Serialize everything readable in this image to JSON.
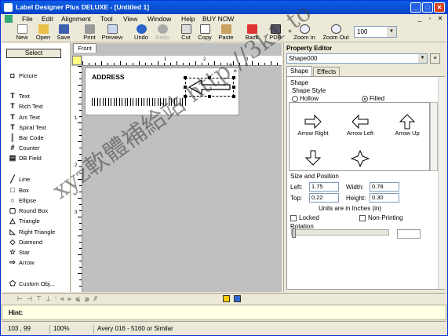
{
  "title": "Label Designer Plus DELUXE - [Untitled 1]",
  "menu": [
    "File",
    "Edit",
    "Alignment",
    "Tool",
    "View",
    "Window",
    "Help",
    "BUY NOW"
  ],
  "toolbar": {
    "new": "New",
    "open": "Open",
    "save": "Save",
    "print": "Print",
    "preview": "Preview",
    "undo": "Undo",
    "redo": "Redo",
    "cut": "Cut",
    "copy": "Copy",
    "paste": "Paste",
    "back": "Back",
    "pdb": "PDB",
    "zoom_in": "Zoom In",
    "zoom_out": "Zoom Out",
    "zoom_value": "100"
  },
  "tools": {
    "select": "Select",
    "picture": "Picture",
    "text": "Text",
    "rich_text": "Rich Text",
    "arc_text": "Arc Text",
    "spiral_text": "Spiral Text",
    "bar_code": "Bar Code",
    "counter": "Counter",
    "db_field": "DB Field",
    "line": "Line",
    "box": "Box",
    "ellipse": "Ellipse",
    "round_box": "Round Box",
    "triangle": "Triangle",
    "right_triangle": "Right Triangle",
    "diamond": "Diamond",
    "star": "Star",
    "arrow": "Arrow",
    "custom": "Custom Obj..."
  },
  "canvas": {
    "tab": "Front",
    "label_text": "ADDRESS",
    "hruler": [
      "1",
      "2",
      "3"
    ],
    "vruler": [
      "1",
      "2",
      "3"
    ]
  },
  "property_editor": {
    "title": "Property Editor",
    "object": "Shape000",
    "tabs": [
      "Shape",
      "Effects"
    ],
    "shape_group": "Shape",
    "shape_style": "Shape Style",
    "hollow": "Hollow",
    "filled": "Filled",
    "gallery": [
      "Arrow Right",
      "Arrow Left",
      "Arrow Up"
    ],
    "size_position": "Size and Position",
    "left_label": "Left:",
    "left_val": "1.75",
    "width_label": "Width:",
    "width_val": "0.78",
    "top_label": "Top:",
    "top_val": "0.22",
    "height_label": "Height:",
    "height_val": "0.30",
    "units": "Units are in Inches (in)",
    "locked": "Locked",
    "non_printing": "Non-Printing",
    "rotation": "Rotation"
  },
  "hint": {
    "label": "Hint:"
  },
  "status": {
    "coords": "103 , 99",
    "zoom": "100%",
    "label_type": "Avery 016 - 5160 or Similar"
  },
  "watermark": "xyz軟體補給站 http://3k1.to"
}
